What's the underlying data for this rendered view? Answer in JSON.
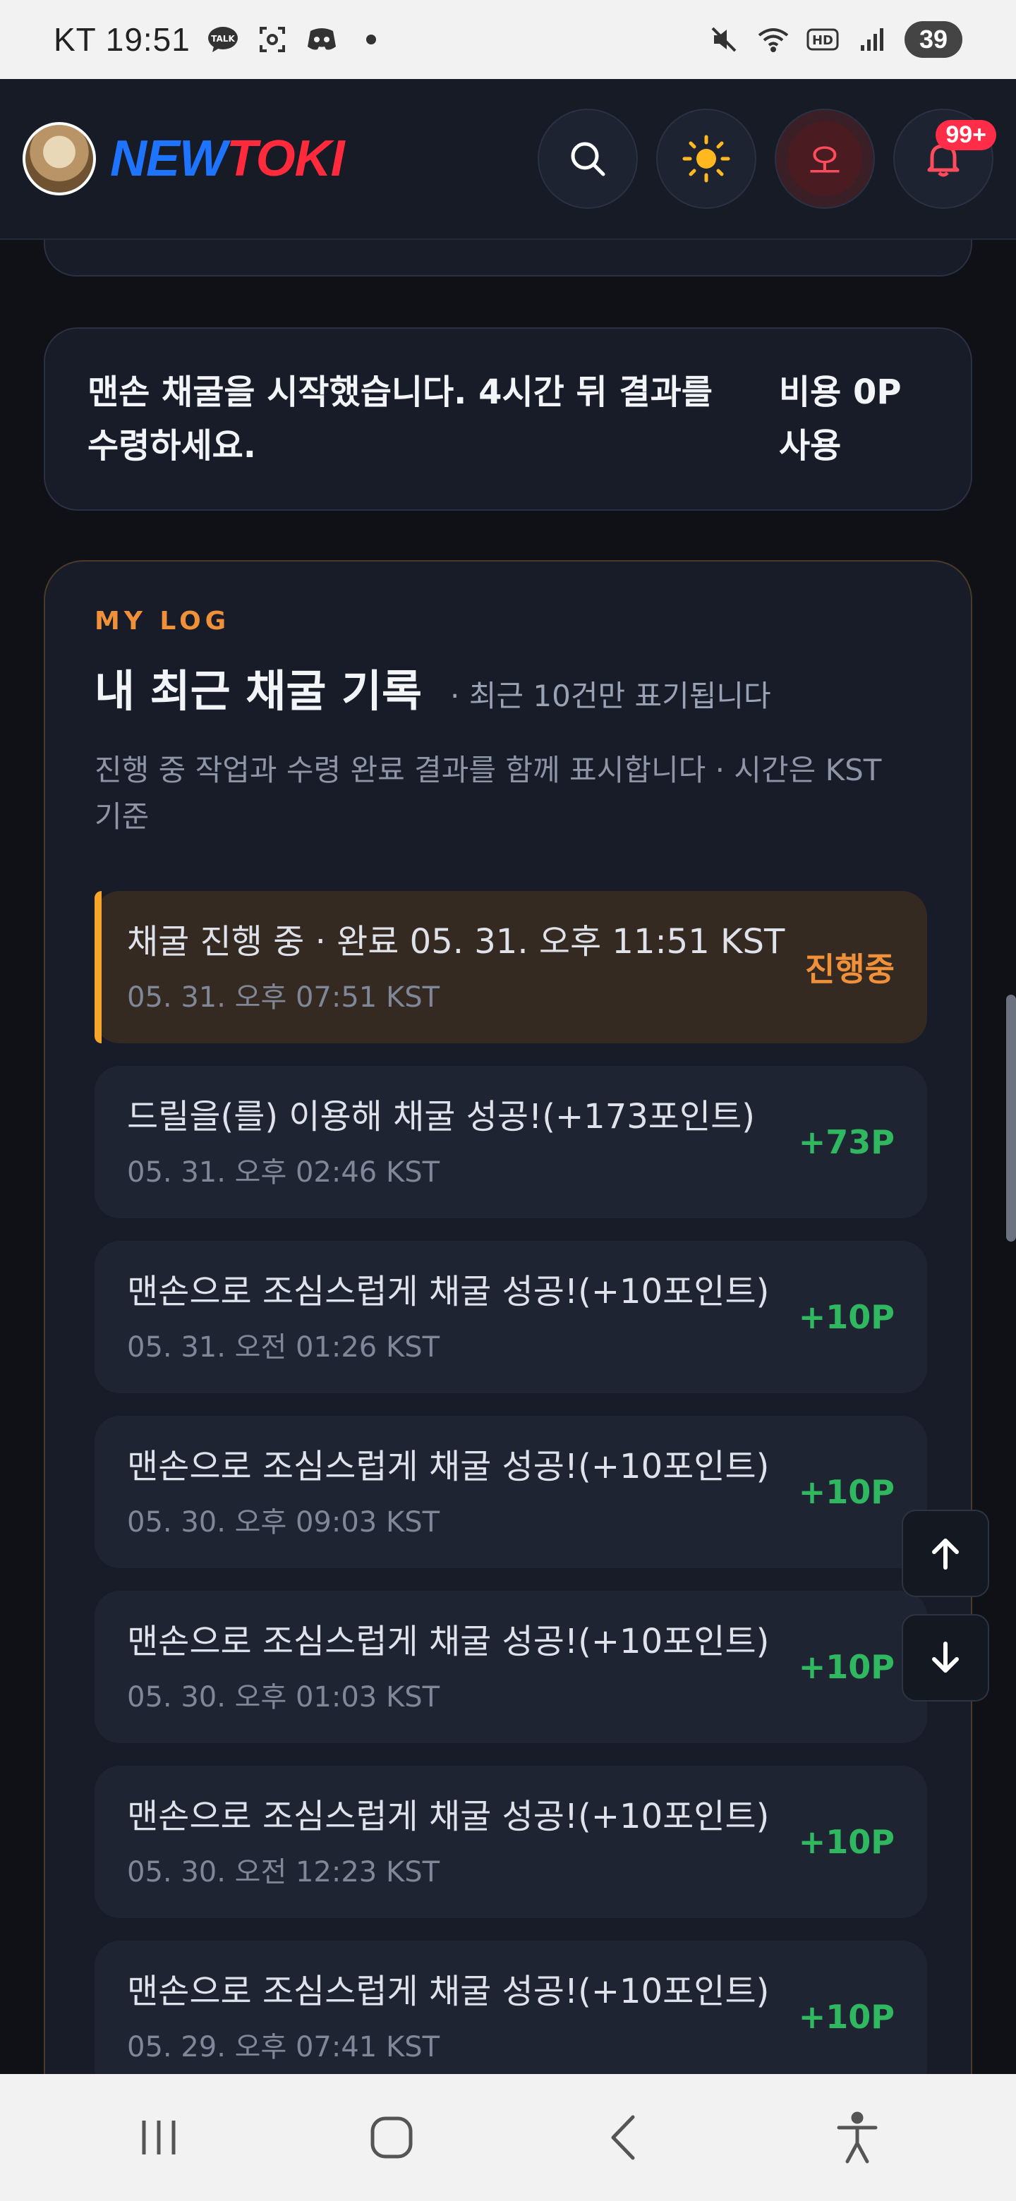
{
  "status_bar": {
    "carrier": "KT",
    "time": "19:51",
    "battery": "39",
    "icons": [
      "talk-icon",
      "screenshot-icon",
      "discord-icon",
      "dot-icon",
      "mute-icon",
      "wifi-icon",
      "hd-icon",
      "signal-icon"
    ]
  },
  "header": {
    "logo_part1": "NEW",
    "logo_part2": "TOKI",
    "user_initial": "오",
    "notification_count": "99+"
  },
  "notice": {
    "message": "맨손 채굴을 시작했습니다. 4시간 뒤 결과를 수령하세요.",
    "cost": "비용 0P 사용"
  },
  "log": {
    "eyebrow": "MY LOG",
    "title": "내 최근 채굴 기록",
    "note": "· 최근 10건만 표기됩니다",
    "description": "진행 중 작업과 수령 완료 결과를 함께 표시합니다 · 시간은 KST 기준",
    "items": [
      {
        "message": "채굴 진행 중 · 완료 05. 31. 오후 11:51 KST",
        "time": "05. 31. 오후 07:51 KST",
        "value": "진행중",
        "status": "pending"
      },
      {
        "message": "드릴을(를) 이용해 채굴 성공!(+173포인트)",
        "time": "05. 31. 오후 02:46 KST",
        "value": "+73P",
        "status": "done"
      },
      {
        "message": "맨손으로 조심스럽게 채굴 성공!(+10포인트)",
        "time": "05. 31. 오전 01:26 KST",
        "value": "+10P",
        "status": "done"
      },
      {
        "message": "맨손으로 조심스럽게 채굴 성공!(+10포인트)",
        "time": "05. 30. 오후 09:03 KST",
        "value": "+10P",
        "status": "done"
      },
      {
        "message": "맨손으로 조심스럽게 채굴 성공!(+10포인트)",
        "time": "05. 30. 오후 01:03 KST",
        "value": "+10P",
        "status": "done"
      },
      {
        "message": "맨손으로 조심스럽게 채굴 성공!(+10포인트)",
        "time": "05. 30. 오전 12:23 KST",
        "value": "+10P",
        "status": "done"
      },
      {
        "message": "맨손으로 조심스럽게 채굴 성공!(+10포인트)",
        "time": "05. 29. 오후 07:41 KST",
        "value": "+10P",
        "status": "done"
      }
    ]
  },
  "colors": {
    "background": "#0f1117",
    "card": "#171c28",
    "accent_orange": "#f0913a",
    "success_green": "#2fb860",
    "logo_blue": "#1e74ff",
    "logo_red": "#ff2a3c"
  }
}
